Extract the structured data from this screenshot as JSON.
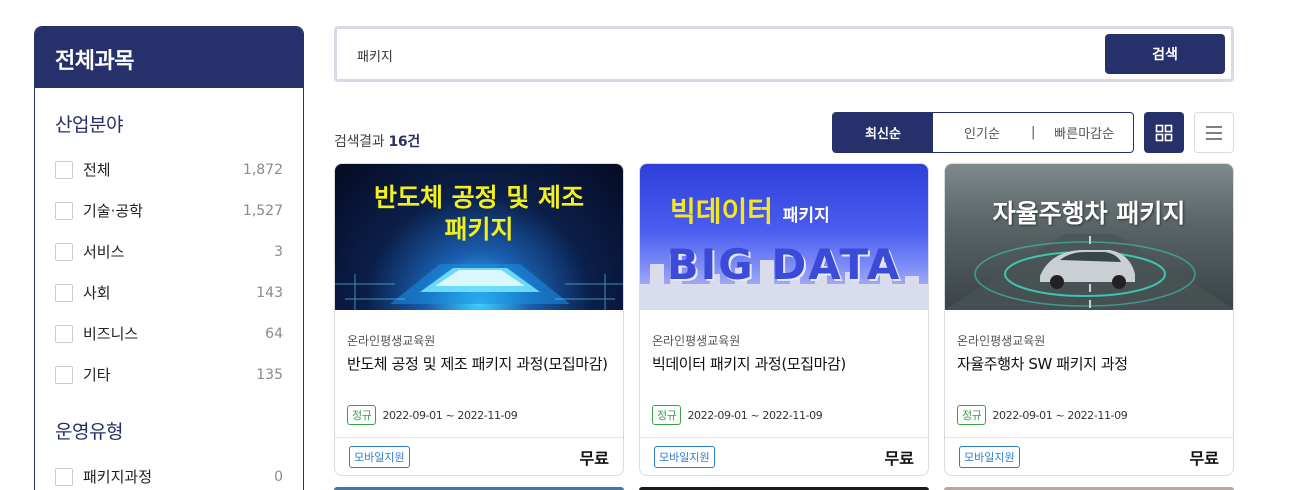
{
  "sidebar": {
    "title": "전체과목",
    "section1": "산업분야",
    "categories": [
      {
        "label": "전체",
        "count": "1,872"
      },
      {
        "label": "기술·공학",
        "count": "1,527"
      },
      {
        "label": "서비스",
        "count": "3"
      },
      {
        "label": "사회",
        "count": "143"
      },
      {
        "label": "비즈니스",
        "count": "64"
      },
      {
        "label": "기타",
        "count": "135"
      }
    ],
    "section2": "운영유형",
    "types": [
      {
        "label": "패키지과정",
        "count": "0"
      }
    ]
  },
  "search": {
    "value": "패키지",
    "button": "검색"
  },
  "results": {
    "prefix": "검색결과 ",
    "count": "16건"
  },
  "sort": {
    "latest": "최신순",
    "popular": "인기순",
    "separator": "|",
    "deadline": "빠른마감순"
  },
  "view_icons": {
    "grid": "grid-icon",
    "list": "list-icon"
  },
  "colors": {
    "primary": "#26306a",
    "regular_tag": "#3aa14a",
    "mobile_tag": "#2a7fd0"
  },
  "cards": [
    {
      "thumb_line1": "반도체 공정 및 제조",
      "thumb_line2": "패키지",
      "institution": "온라인평생교육원",
      "title": "반도체 공정 및 제조 패키지 과정(모집마감)",
      "tag": "정규",
      "period": "2022-09-01 ~ 2022-11-09",
      "mobile": "모바일지원",
      "price": "무료"
    },
    {
      "thumb_line1": "빅데이터",
      "thumb_line1b": "패키지",
      "thumb_line2": "BIG DATA",
      "institution": "온라인평생교육원",
      "title": "빅데이터 패키지 과정(모집마감)",
      "tag": "정규",
      "period": "2022-09-01 ~ 2022-11-09",
      "mobile": "모바일지원",
      "price": "무료"
    },
    {
      "thumb_line1": "자율주행차 패키지",
      "institution": "온라인평생교육원",
      "title": "자율주행차 SW 패키지 과정",
      "tag": "정규",
      "period": "2022-09-01 ~ 2022-11-09",
      "mobile": "모바일지원",
      "price": "무료"
    }
  ]
}
